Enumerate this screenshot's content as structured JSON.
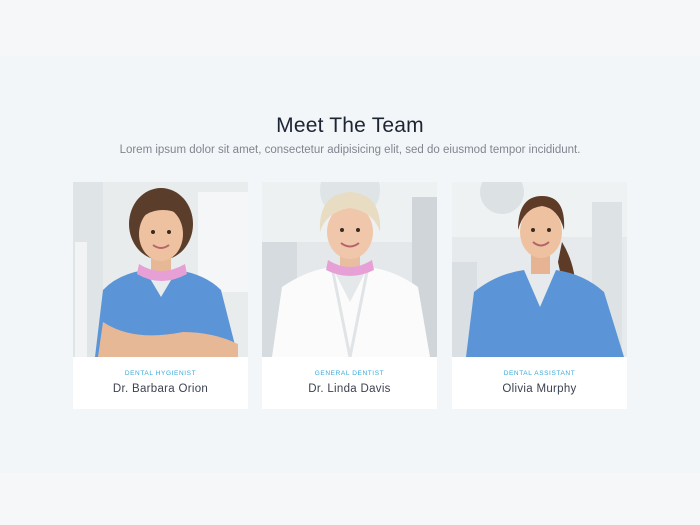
{
  "section": {
    "title": "Meet The Team",
    "subtitle": "Lorem ipsum dolor sit amet, consectetur adipisicing elit, sed do eiusmod tempor incididunt."
  },
  "team": [
    {
      "role": "DENTAL HYGIENIST",
      "name": "Dr. Barbara Orion"
    },
    {
      "role": "GENERAL DENTIST",
      "name": "Dr. Linda Davis"
    },
    {
      "role": "DENTAL ASSISTANT",
      "name": "Olivia Murphy"
    }
  ],
  "colors": {
    "background": "#f3f6f9",
    "title": "#1d2433",
    "accent": "#35a9da",
    "scrubs": "#5b95d8",
    "mask": "#e6a0d6"
  }
}
